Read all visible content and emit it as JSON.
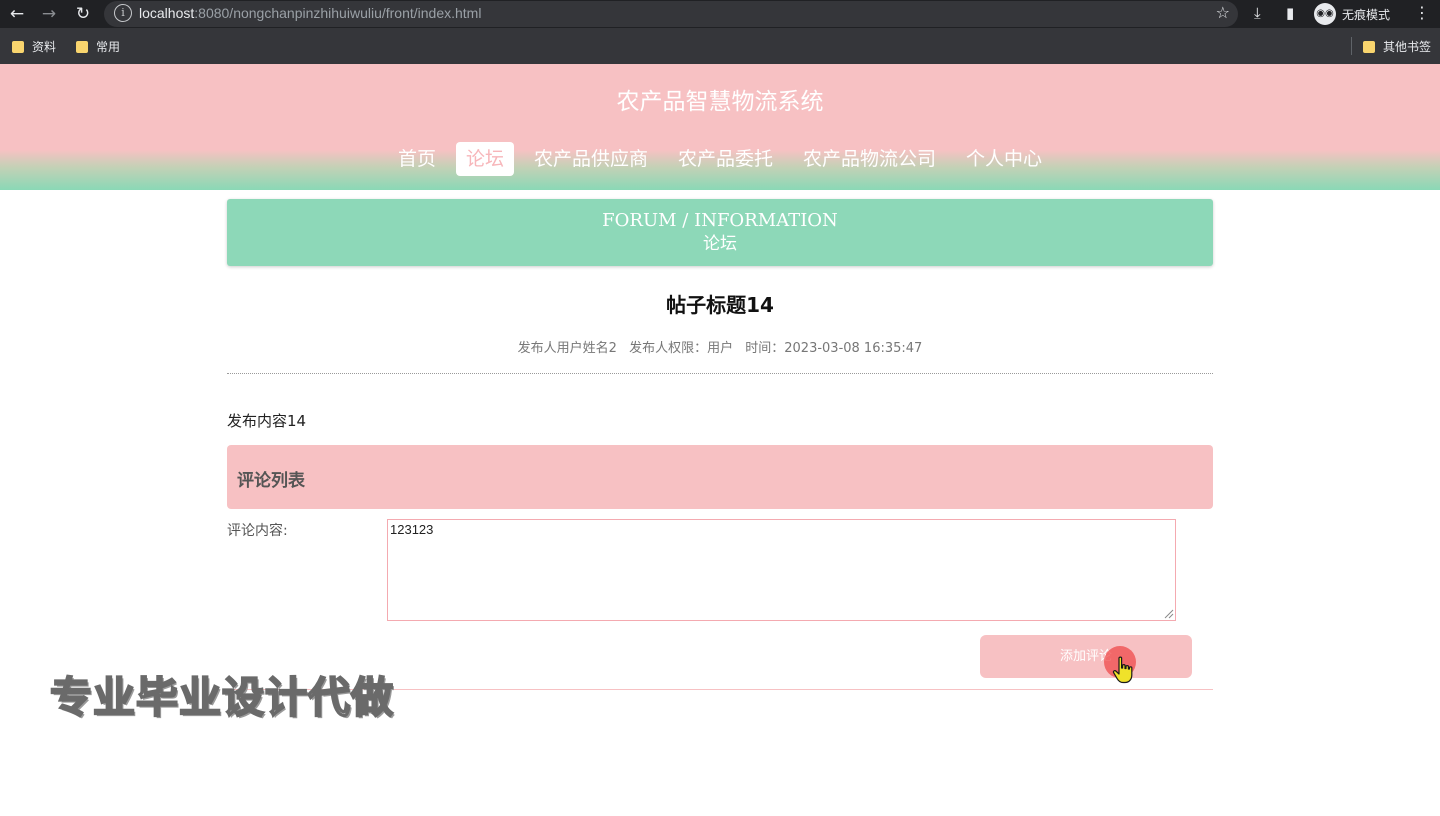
{
  "browser": {
    "url_host": "localhost",
    "url_rest": ":8080/nongchanpinzhihuiwuliu/front/index.html",
    "incognito_label": "无痕模式",
    "bookmarks": [
      "资料",
      "常用"
    ],
    "other_bookmarks": "其他书签"
  },
  "site": {
    "title": "农产品智慧物流系统",
    "nav": [
      "首页",
      "论坛",
      "农产品供应商",
      "农产品委托",
      "农产品物流公司",
      "个人中心"
    ],
    "active_nav": "论坛"
  },
  "banner": {
    "en": "FORUM / INFORMATION",
    "cn": "论坛"
  },
  "post": {
    "title": "帖子标题14",
    "author": "发布人用户姓名2",
    "role": "发布人权限：用户",
    "time": "时间：2023-03-08 16:35:47",
    "content": "发布内容14"
  },
  "comments": {
    "header": "评论列表",
    "label": "评论内容:",
    "input_value": "123123",
    "submit_label": "添加评论"
  },
  "overlay": {
    "watermark": "专业毕业设计代做"
  },
  "colors": {
    "pink": "#f7c1c3",
    "mint": "#8dd8b8",
    "chrome": "#202124"
  }
}
